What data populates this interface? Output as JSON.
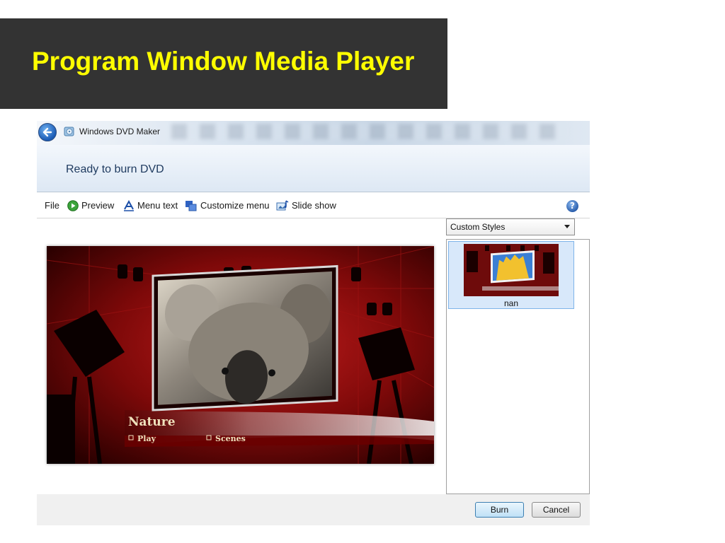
{
  "slide": {
    "title": "Program Window Media Player"
  },
  "window": {
    "title": "Windows DVD Maker"
  },
  "header": {
    "text": "Ready to burn DVD"
  },
  "toolbar": {
    "file": "File",
    "preview": "Preview",
    "menu_text": "Menu text",
    "customize_menu": "Customize menu",
    "slide_show": "Slide show"
  },
  "preview": {
    "menu_title": "Nature",
    "play_label": "Play",
    "scenes_label": "Scenes"
  },
  "styles": {
    "dropdown_value": "Custom Styles",
    "items": [
      {
        "label": "nan"
      }
    ]
  },
  "footer": {
    "burn": "Burn",
    "cancel": "Cancel"
  },
  "colors": {
    "banner_bg": "#333333",
    "banner_text": "#ffff00",
    "header_text": "#1e3a5f",
    "selection_bg": "#d8e8fa",
    "stage_red": "#8b0a0a"
  }
}
